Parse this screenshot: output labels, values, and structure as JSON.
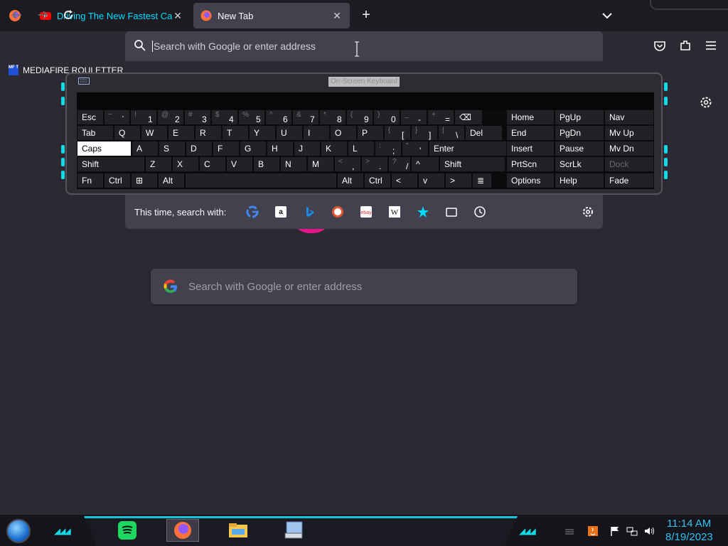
{
  "tabs": [
    {
      "label": "Driving The New Fastest Car Ev",
      "active": false,
      "favicon": "youtube-icon",
      "color": "#00ddff"
    },
    {
      "label": "New Tab",
      "active": true,
      "favicon": "firefox-icon",
      "color": "#fbfbfe"
    }
  ],
  "toolbar": {
    "url_placeholder": "Search with Google or enter address"
  },
  "bookmarks": [
    {
      "label": "MEDIAFIRE ROULETTER",
      "icon_text": "MF T"
    }
  ],
  "osk": {
    "title": "On-Screen Keyboard",
    "rows": [
      [
        {
          "pri": "Esc"
        },
        {
          "sec": "~",
          "pri": "`"
        },
        {
          "sec": "!",
          "pri": "1"
        },
        {
          "sec": "@",
          "pri": "2"
        },
        {
          "sec": "#",
          "pri": "3"
        },
        {
          "sec": "$",
          "pri": "4"
        },
        {
          "sec": "%",
          "pri": "5"
        },
        {
          "sec": "^",
          "pri": "6"
        },
        {
          "sec": "&",
          "pri": "7"
        },
        {
          "sec": "*",
          "pri": "8"
        },
        {
          "sec": "(",
          "pri": "9"
        },
        {
          "sec": ")",
          "pri": "0"
        },
        {
          "sec": "_",
          "pri": "-"
        },
        {
          "sec": "+",
          "pri": "="
        },
        {
          "pri": "⌫"
        }
      ],
      [
        {
          "pri": "Tab"
        },
        {
          "pri": "Q"
        },
        {
          "pri": "W"
        },
        {
          "pri": "E"
        },
        {
          "pri": "R"
        },
        {
          "pri": "T"
        },
        {
          "pri": "Y"
        },
        {
          "pri": "U"
        },
        {
          "pri": "I"
        },
        {
          "pri": "O"
        },
        {
          "pri": "P"
        },
        {
          "sec": "{",
          "pri": "["
        },
        {
          "sec": "}",
          "pri": "]"
        },
        {
          "sec": "|",
          "pri": "\\"
        },
        {
          "pri": "Del"
        }
      ],
      [
        {
          "pri": "Caps"
        },
        {
          "pri": "A"
        },
        {
          "pri": "S"
        },
        {
          "pri": "D"
        },
        {
          "pri": "F"
        },
        {
          "pri": "G"
        },
        {
          "pri": "H"
        },
        {
          "pri": "J"
        },
        {
          "pri": "K"
        },
        {
          "pri": "L"
        },
        {
          "sec": ":",
          "pri": ";"
        },
        {
          "sec": "\"",
          "pri": "'"
        },
        {
          "pri": "Enter"
        }
      ],
      [
        {
          "pri": "Shift"
        },
        {
          "pri": "Z"
        },
        {
          "pri": "X"
        },
        {
          "pri": "C"
        },
        {
          "pri": "V"
        },
        {
          "pri": "B"
        },
        {
          "pri": "N"
        },
        {
          "pri": "M"
        },
        {
          "sec": "<",
          "pri": ","
        },
        {
          "sec": ">",
          "pri": "."
        },
        {
          "sec": "?",
          "pri": "/"
        },
        {
          "pri": "^"
        },
        {
          "pri": "Shift"
        }
      ],
      [
        {
          "pri": "Fn"
        },
        {
          "pri": "Ctrl"
        },
        {
          "pri": "⊞"
        },
        {
          "pri": "Alt"
        },
        {
          "pri": ""
        },
        {
          "pri": "Alt"
        },
        {
          "pri": "Ctrl"
        },
        {
          "pri": "<"
        },
        {
          "pri": "v"
        },
        {
          "pri": ">"
        },
        {
          "pri": "≣"
        }
      ]
    ],
    "nav_rows": [
      [
        "Home",
        "PgUp",
        "Nav"
      ],
      [
        "End",
        "PgDn",
        "Mv Up"
      ],
      [
        "Insert",
        "Pause",
        "Mv Dn"
      ],
      [
        "PrtScn",
        "ScrLk",
        "Dock"
      ],
      [
        "Options",
        "Help",
        "Fade"
      ]
    ]
  },
  "search_row": {
    "label": "This time, search with:",
    "engines": [
      "google-icon",
      "amazon-icon",
      "bing-icon",
      "duckduckgo-icon",
      "ebay-icon",
      "wikipedia-icon",
      "bookmarks-star-icon",
      "tabs-icon",
      "history-icon"
    ]
  },
  "page_search": {
    "placeholder": "Search with Google or enter address"
  },
  "taskbar": {
    "apps": [
      "spotify-icon",
      "firefox-icon",
      "file-explorer-icon",
      "on-screen-keyboard-icon"
    ],
    "clock_time": "11:14 AM",
    "clock_date": "8/19/2023",
    "accent": "#13d9e6"
  }
}
